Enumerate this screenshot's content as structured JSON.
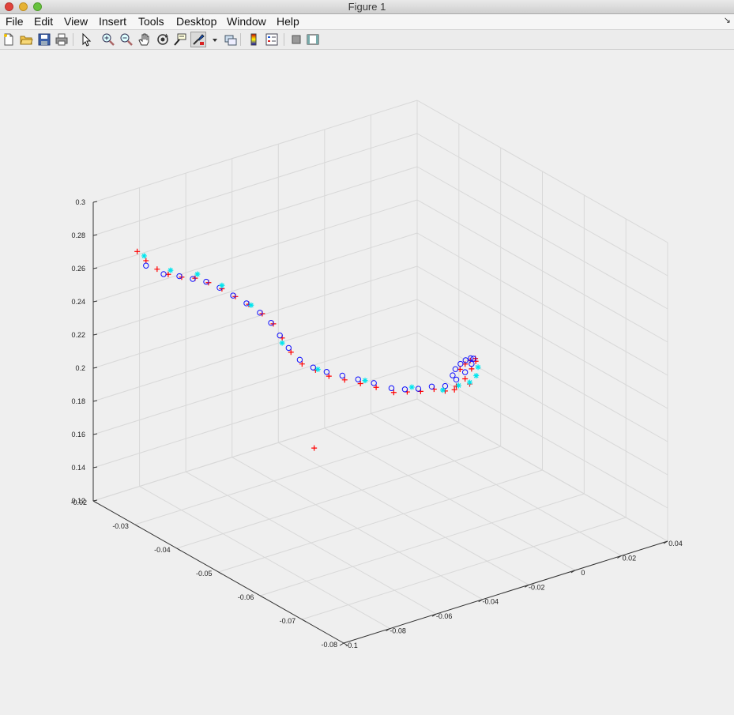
{
  "window": {
    "title": "Figure 1"
  },
  "menu": {
    "items": [
      "File",
      "Edit",
      "View",
      "Insert",
      "Tools",
      "Desktop",
      "Window",
      "Help"
    ]
  },
  "toolbar": {
    "icons": [
      "new-figure-icon",
      "open-file-icon",
      "save-icon",
      "print-icon",
      "pointer-icon",
      "zoom-in-icon",
      "zoom-out-icon",
      "pan-hand-icon",
      "rotate-3d-icon",
      "data-cursor-icon",
      "brush-icon",
      "brush-dropdown-icon",
      "link-plot-icon",
      "colorbar-icon",
      "legend-icon",
      "hide-plot-tools-icon",
      "show-plot-tools-icon"
    ]
  },
  "chart_data": {
    "type": "scatter",
    "title": "",
    "xlabel": "",
    "ylabel": "",
    "zlabel": "",
    "xlim": [
      -0.1,
      0.04
    ],
    "ylim": [
      -0.08,
      -0.02
    ],
    "zlim": [
      0.12,
      0.3
    ],
    "xticks": [
      "-0.1",
      "-0.08",
      "-0.06",
      "-0.04",
      "-0.02",
      "0",
      "0.02",
      "0.04"
    ],
    "yticks": [
      "-0.08",
      "-0.07",
      "-0.06",
      "-0.05",
      "-0.04",
      "-0.03",
      "-0.02"
    ],
    "zticks": [
      "0.12",
      "0.14",
      "0.16",
      "0.18",
      "0.2",
      "0.22",
      "0.24",
      "0.26",
      "0.28",
      "0.3"
    ],
    "grid": true,
    "series": [
      {
        "marker": "+",
        "color": "#ff0000",
        "points": [
          [
            -0.081,
            -0.02,
            0.262
          ],
          [
            -0.079,
            -0.021,
            0.257
          ],
          [
            -0.076,
            -0.022,
            0.252
          ],
          [
            -0.073,
            -0.023,
            0.249
          ],
          [
            -0.069,
            -0.024,
            0.247
          ],
          [
            -0.065,
            -0.025,
            0.246
          ],
          [
            -0.061,
            -0.026,
            0.243
          ],
          [
            -0.057,
            -0.027,
            0.239
          ],
          [
            -0.053,
            -0.028,
            0.234
          ],
          [
            -0.049,
            -0.029,
            0.229
          ],
          [
            -0.045,
            -0.03,
            0.223
          ],
          [
            -0.042,
            -0.031,
            0.217
          ],
          [
            -0.04,
            -0.032,
            0.209
          ],
          [
            -0.038,
            -0.033,
            0.201
          ],
          [
            -0.035,
            -0.034,
            0.194
          ],
          [
            -0.031,
            -0.035,
            0.19
          ],
          [
            -0.027,
            -0.036,
            0.186
          ],
          [
            -0.022,
            -0.037,
            0.183
          ],
          [
            -0.017,
            -0.038,
            0.18
          ],
          [
            -0.012,
            -0.039,
            0.177
          ],
          [
            -0.008,
            -0.041,
            0.175
          ],
          [
            -0.004,
            -0.042,
            0.175
          ],
          [
            0.0,
            -0.043,
            0.175
          ],
          [
            0.004,
            -0.044,
            0.176
          ],
          [
            0.007,
            -0.045,
            0.175
          ],
          [
            0.01,
            -0.046,
            0.178
          ],
          [
            0.012,
            -0.047,
            0.183
          ],
          [
            0.013,
            -0.048,
            0.19
          ],
          [
            0.013,
            -0.049,
            0.196
          ],
          [
            0.011,
            -0.05,
            0.2
          ],
          [
            0.007,
            -0.051,
            0.202
          ],
          [
            0.003,
            -0.052,
            0.203
          ],
          [
            -0.001,
            -0.053,
            0.203
          ],
          [
            0.014,
            -0.047,
            0.179
          ],
          [
            0.011,
            -0.045,
            0.174
          ],
          [
            -0.046,
            -0.043,
            0.161
          ]
        ]
      },
      {
        "marker": "o",
        "color": "#1010ff",
        "points": [
          [
            -0.079,
            -0.021,
            0.254
          ],
          [
            -0.075,
            -0.023,
            0.25
          ],
          [
            -0.07,
            -0.024,
            0.248
          ],
          [
            -0.066,
            -0.025,
            0.246
          ],
          [
            -0.062,
            -0.026,
            0.244
          ],
          [
            -0.058,
            -0.027,
            0.24
          ],
          [
            -0.054,
            -0.028,
            0.235
          ],
          [
            -0.05,
            -0.029,
            0.23
          ],
          [
            -0.046,
            -0.03,
            0.224
          ],
          [
            -0.043,
            -0.031,
            0.218
          ],
          [
            -0.041,
            -0.032,
            0.211
          ],
          [
            -0.039,
            -0.033,
            0.204
          ],
          [
            -0.036,
            -0.034,
            0.197
          ],
          [
            -0.032,
            -0.035,
            0.192
          ],
          [
            -0.028,
            -0.036,
            0.189
          ],
          [
            -0.023,
            -0.037,
            0.186
          ],
          [
            -0.018,
            -0.038,
            0.183
          ],
          [
            -0.013,
            -0.039,
            0.18
          ],
          [
            -0.009,
            -0.041,
            0.178
          ],
          [
            -0.005,
            -0.042,
            0.177
          ],
          [
            -0.001,
            -0.043,
            0.177
          ],
          [
            0.003,
            -0.044,
            0.178
          ],
          [
            0.007,
            -0.045,
            0.178
          ],
          [
            0.01,
            -0.046,
            0.182
          ],
          [
            0.012,
            -0.047,
            0.187
          ],
          [
            0.013,
            -0.048,
            0.193
          ],
          [
            0.012,
            -0.049,
            0.198
          ],
          [
            0.009,
            -0.05,
            0.201
          ],
          [
            0.005,
            -0.051,
            0.203
          ],
          [
            0.001,
            -0.052,
            0.204
          ],
          [
            -0.003,
            -0.053,
            0.204
          ],
          [
            -0.006,
            -0.054,
            0.203
          ]
        ]
      },
      {
        "marker": "*",
        "color": "#00e5ee",
        "points": [
          [
            -0.078,
            -0.02,
            0.258
          ],
          [
            -0.072,
            -0.023,
            0.251
          ],
          [
            -0.064,
            -0.025,
            0.248
          ],
          [
            -0.057,
            -0.027,
            0.241
          ],
          [
            -0.048,
            -0.029,
            0.228
          ],
          [
            -0.04,
            -0.032,
            0.206
          ],
          [
            -0.03,
            -0.035,
            0.19
          ],
          [
            -0.015,
            -0.038,
            0.181
          ],
          [
            -0.002,
            -0.042,
            0.177
          ],
          [
            0.006,
            -0.045,
            0.176
          ],
          [
            0.011,
            -0.046,
            0.178
          ],
          [
            0.014,
            -0.047,
            0.18
          ],
          [
            0.015,
            -0.048,
            0.185
          ],
          [
            0.014,
            -0.049,
            0.192
          ]
        ]
      }
    ]
  }
}
